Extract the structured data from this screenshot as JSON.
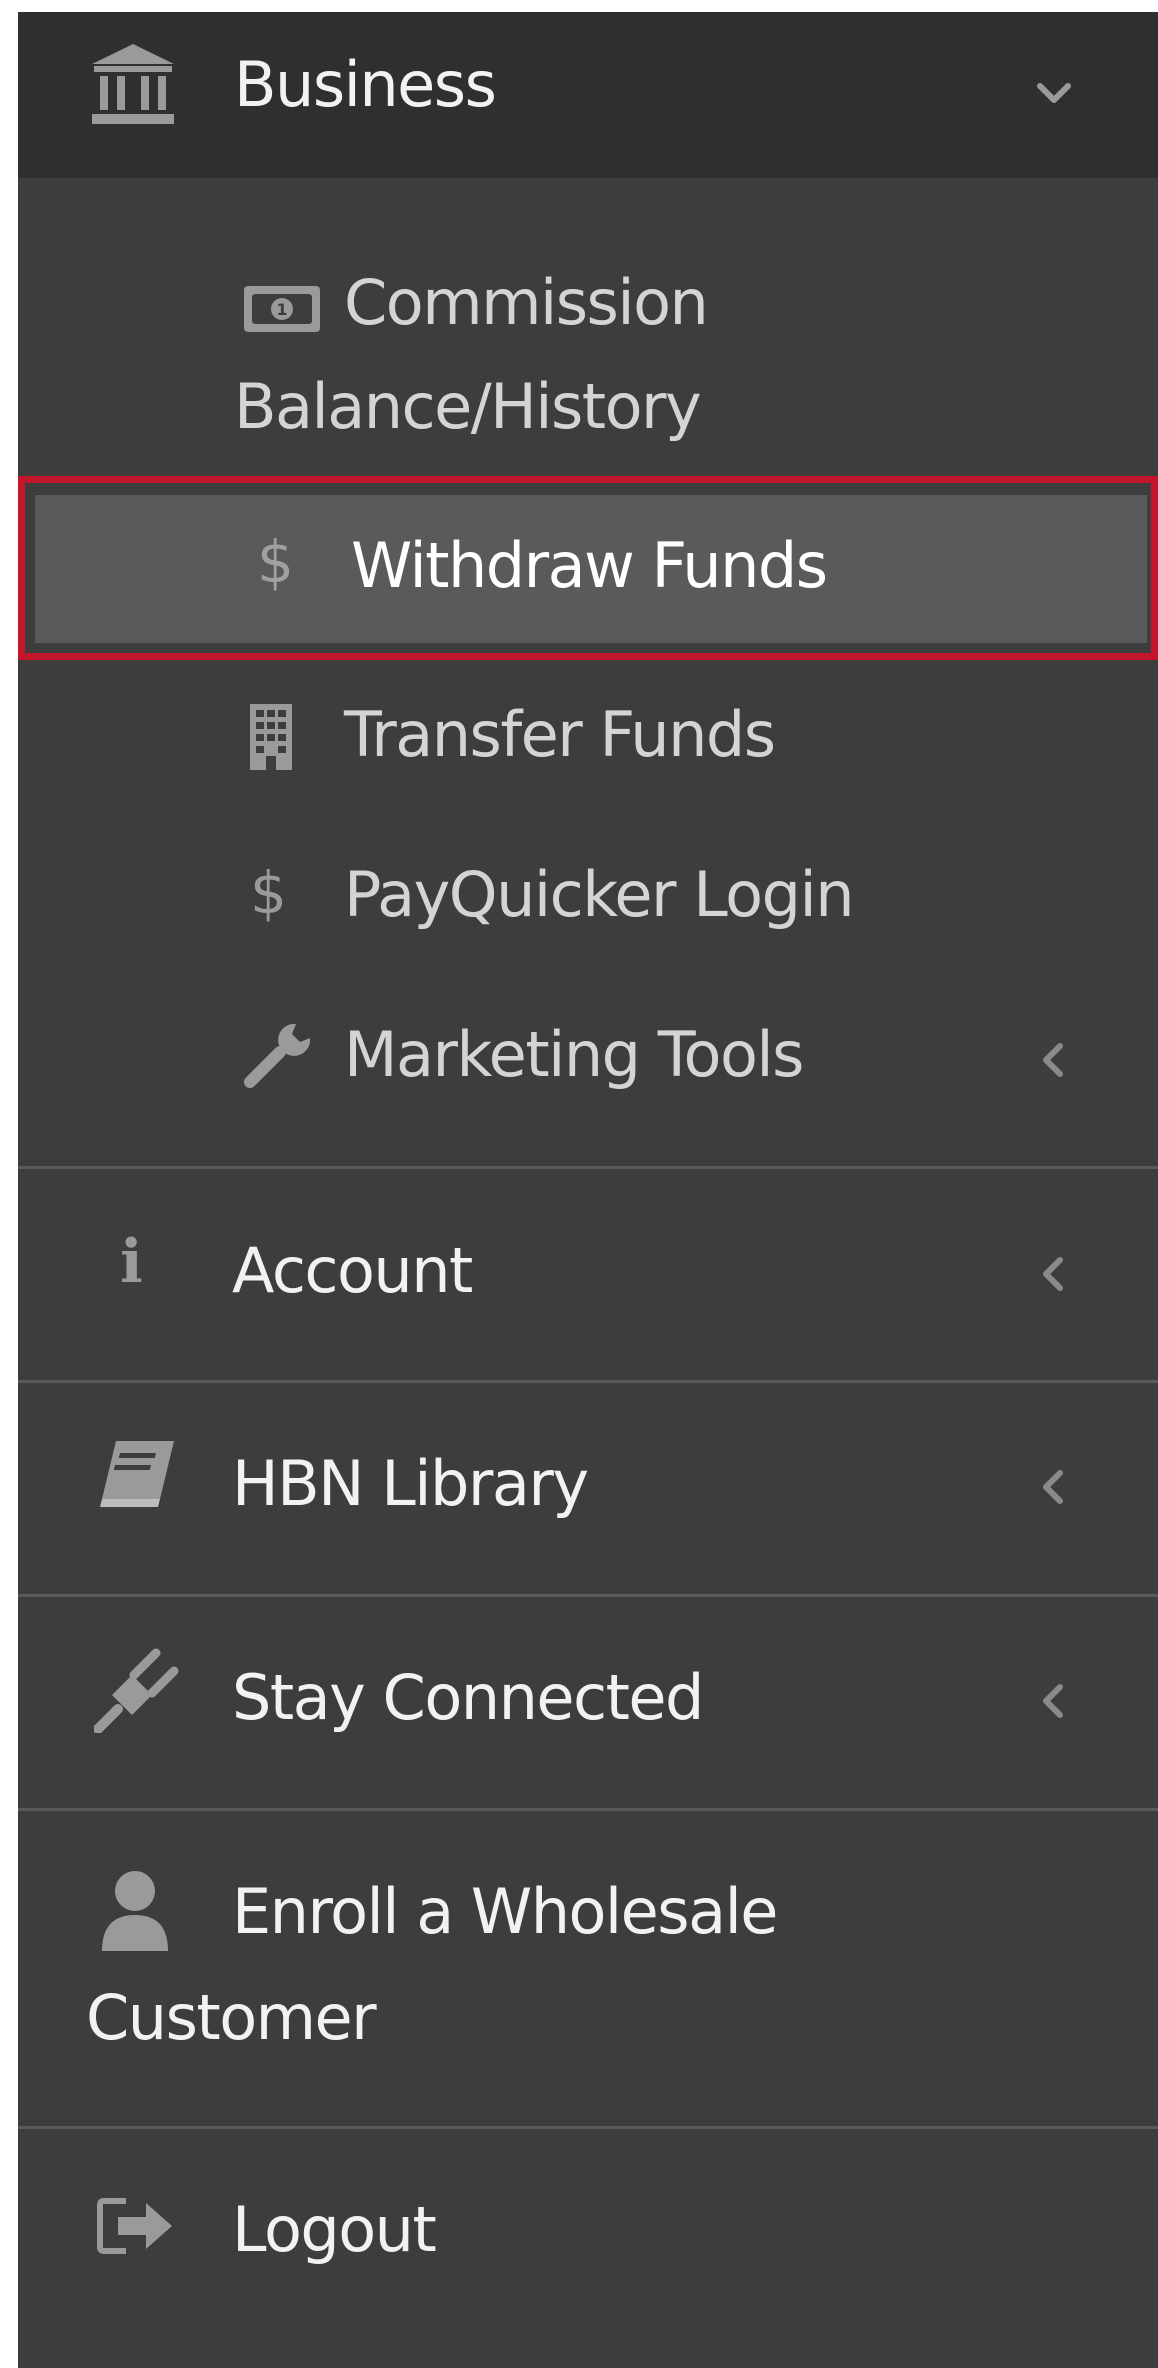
{
  "business": {
    "label": "Business",
    "icon": "bank-icon",
    "chevron": "chevron-down-icon"
  },
  "submenu": [
    {
      "label_line1": "Commission",
      "label_line2": "Balance/History",
      "icon": "money-bill-icon"
    },
    {
      "label": "Withdraw Funds",
      "icon": "dollar-icon",
      "active": true
    },
    {
      "label": "Transfer Funds",
      "icon": "building-icon"
    },
    {
      "label": "PayQuicker Login",
      "icon": "dollar-icon"
    },
    {
      "label": "Marketing Tools",
      "icon": "wrench-icon",
      "chevron": "chevron-left-icon"
    }
  ],
  "menu": [
    {
      "label": "Account",
      "icon": "info-icon",
      "chevron": "chevron-left-icon"
    },
    {
      "label": "HBN Library",
      "icon": "book-icon",
      "chevron": "chevron-left-icon"
    },
    {
      "label": "Stay Connected",
      "icon": "plug-icon",
      "chevron": "chevron-left-icon"
    },
    {
      "label_line1": "Enroll a Wholesale",
      "label_line2": "Customer",
      "icon": "user-icon"
    },
    {
      "label": "Logout",
      "icon": "sign-out-icon"
    }
  ],
  "colors": {
    "sidebar_bg": "#3d3d3d",
    "header_bg": "#2f2f2f",
    "active_bg": "#5a5a5a",
    "highlight_border": "#c4162a",
    "text": "#f2f2f2",
    "icon": "#9a9a9a"
  }
}
